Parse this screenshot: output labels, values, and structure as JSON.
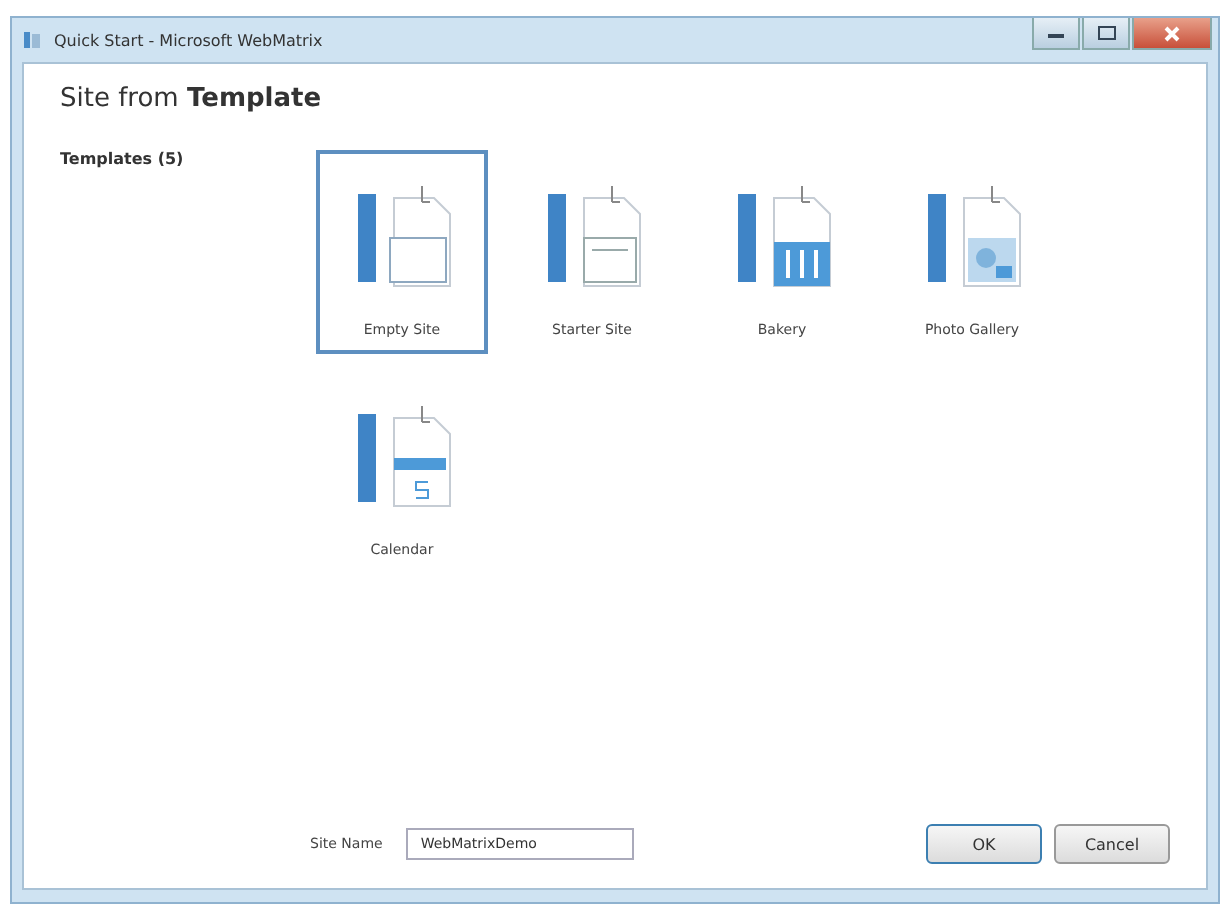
{
  "window": {
    "title": "Quick Start - Microsoft WebMatrix"
  },
  "heading": "Site from **Template**",
  "sidebar": {
    "label": "Templates (5)"
  },
  "templates": [
    {
      "label": "Empty Site",
      "kind": "empty",
      "selected": true
    },
    {
      "label": "Starter Site",
      "kind": "starter",
      "selected": false
    },
    {
      "label": "Bakery",
      "kind": "bakery",
      "selected": false
    },
    {
      "label": "Photo Gallery",
      "kind": "gallery",
      "selected": false
    },
    {
      "label": "Calendar",
      "kind": "calendar",
      "selected": false
    }
  ],
  "site_name": {
    "label": "Site Name",
    "value": "WebMatrixDemo"
  },
  "buttons": [
    {
      "label": "OK",
      "kind": "default"
    },
    {
      "label": "Cancel",
      "kind": "normal"
    }
  ]
}
